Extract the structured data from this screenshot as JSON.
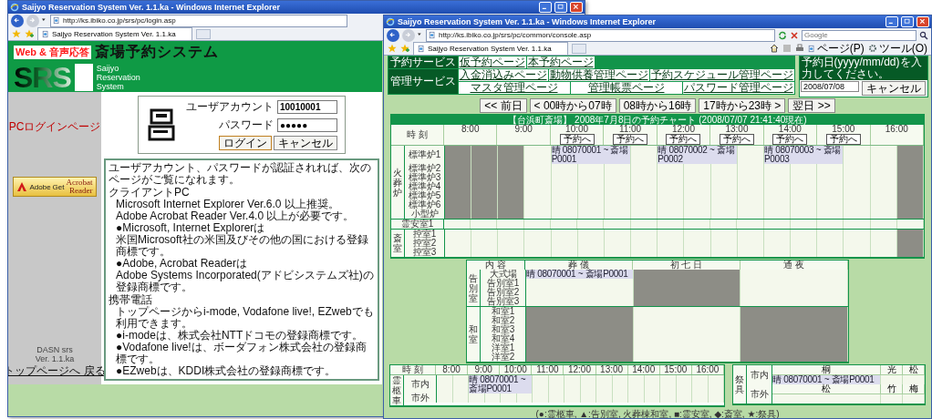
{
  "login_window": {
    "title": "Saijyo Reservation System Ver. 1.1.ka - Windows Internet Explorer",
    "address": "http://ks.ibiko.co.jp/srs/pc/login.asp",
    "tab": "Saijyo Reservation System Ver. 1.1.ka",
    "banner": {
      "tagline": "Web & 音声応答",
      "title": "斎場予約システム",
      "logo": "SRS",
      "subtitle": [
        "Saijyo",
        "Reservation",
        "System"
      ]
    },
    "sidebar": {
      "page_label": "PCログインページ",
      "badge": {
        "get": "Get",
        "name": "Acrobat",
        "reader": "Reader",
        "maker": "Adobe"
      },
      "footer": [
        "DASN srs",
        "Ver. 1.1.ka"
      ],
      "link": "トップページへ 戻る"
    },
    "login": {
      "fields": [
        {
          "label": "ユーザアカウント",
          "value": "10010001"
        },
        {
          "label": "パスワード",
          "value": "●●●●●"
        }
      ],
      "buttons": [
        "ログイン",
        "キャンセル"
      ]
    },
    "notice": {
      "heading": "ユーザアカウント、パスワードが認証されれば、次のページがご覧になれます。",
      "sections": [
        {
          "label": "クライアントPC",
          "lines": [
            "Microsoft Internet Explorer Ver.6.0 以上推奨。",
            "Adobe Acrobat Reader Ver.4.0 以上が必要です。",
            "●Microsoft, Internet Explorerは",
            "米国Microsoft社の米国及びその他の国における登録商標です。",
            "●Adobe, Acrobat Readerは",
            "Adobe Systems Incorporated(アドビシステムズ社)の登録商標です。"
          ]
        },
        {
          "label": "携帯電話",
          "lines": [
            "トップページからi-mode, Vodafone live!, EZwebでも利用できます。",
            "●i-modeは、株式会社NTTドコモの登録商標です。",
            "●Vodafone live!は、ボーダフォン株式会社の登録商標です。",
            "●EZwebは、KDDI株式会社の登録商標です。"
          ]
        }
      ]
    }
  },
  "console_window": {
    "title": "Saijyo Reservation System Ver. 1.1.ka - Windows Internet Explorer",
    "address": "http://ks.ibiko.co.jp/srs/pc/common/console.asp",
    "search": {
      "placeholder": "Google"
    },
    "tab": "Saijyo Reservation System Ver. 1.1.ka",
    "toolbar": [
      "ページ(P)",
      "ツール(O)"
    ],
    "menu": [
      {
        "label": "予約サービス",
        "rows": [
          [
            "仮予約ページ",
            "本予約ページ"
          ]
        ]
      },
      {
        "label": "管理サービス",
        "rows": [
          [
            "入金消込みページ",
            "動物供養管理ページ",
            "予約スケジュール管理ページ"
          ],
          [
            "マスタ管理ページ",
            "管理帳票ページ",
            "パスワード管理ページ"
          ]
        ]
      }
    ],
    "date_box": {
      "prompt": "予約日(yyyy/mm/dd)を入力してください。",
      "value": "2008/07/08",
      "button": "キャンセル"
    },
    "nav": [
      "<< 前日",
      "< 00時から07時",
      "08時から16時",
      "17時から23時 >",
      "翌日 >>"
    ],
    "chart": {
      "title": "【台浜町斎場】 2008年7月8日の予約チャート (2008/07/07 21:41:40現在)",
      "time_label": "時 刻",
      "hours": [
        {
          "time": "8:00"
        },
        {
          "time": "9:00"
        },
        {
          "time": "10:00",
          "button": "予約へ"
        },
        {
          "time": "11:00",
          "button": "予約へ"
        },
        {
          "time": "12:00",
          "button": "予約へ"
        },
        {
          "time": "13:00",
          "button": "予約へ"
        },
        {
          "time": "14:00",
          "button": "予約へ"
        },
        {
          "time": "15:00",
          "button": "予約へ"
        },
        {
          "time": "16:00"
        }
      ],
      "groups": [
        {
          "label": "火葬炉",
          "rows": [
            {
              "label": "標準炉1",
              "cells": [
                {
                  "kind": "blocked"
                },
                {
                  "kind": "blocked"
                },
                {
                  "kind": "blocked"
                },
                {
                  "kind": "free"
                },
                {
                  "kind": "booking",
                  "text": "晴 08070001 ~ 斎場P0001"
                },
                {
                  "kind": "booked"
                },
                {
                  "kind": "booked"
                },
                {
                  "kind": "free"
                },
                {
                  "kind": "booking",
                  "text": "晴 08070002 ~ 斎場P0002"
                },
                {
                  "kind": "booked"
                },
                {
                  "kind": "booked"
                },
                {
                  "kind": "free"
                },
                {
                  "kind": "booking",
                  "text": "晴 08070003 ~ 斎場P0003"
                },
                {
                  "kind": "booked"
                },
                {
                  "kind": "booked"
                },
                {
                  "kind": "free"
                },
                {
                  "kind": "free"
                },
                {
                  "kind": "blocked"
                }
              ]
            },
            {
              "label": "標準炉2",
              "cells": [
                {
                  "kind": "blocked"
                },
                {
                  "kind": "blocked"
                },
                {
                  "kind": "blocked"
                },
                {
                  "kind": "free"
                },
                {
                  "kind": "free"
                },
                {
                  "kind": "free"
                },
                {
                  "kind": "free"
                },
                {
                  "kind": "free"
                },
                {
                  "kind": "free"
                },
                {
                  "kind": "free"
                },
                {
                  "kind": "free"
                },
                {
                  "kind": "free"
                },
                {
                  "kind": "free"
                },
                {
                  "kind": "free"
                },
                {
                  "kind": "free"
                },
                {
                  "kind": "free"
                },
                {
                  "kind": "free"
                },
                {
                  "kind": "blocked"
                }
              ]
            },
            {
              "label": "標準炉3",
              "cells": [
                {
                  "kind": "blocked"
                },
                {
                  "kind": "blocked"
                },
                {
                  "kind": "blocked"
                },
                {
                  "kind": "free"
                },
                {
                  "kind": "free"
                },
                {
                  "kind": "free"
                },
                {
                  "kind": "free"
                },
                {
                  "kind": "free"
                },
                {
                  "kind": "free"
                },
                {
                  "kind": "free"
                },
                {
                  "kind": "free"
                },
                {
                  "kind": "free"
                },
                {
                  "kind": "free"
                },
                {
                  "kind": "free"
                },
                {
                  "kind": "free"
                },
                {
                  "kind": "free"
                },
                {
                  "kind": "free"
                },
                {
                  "kind": "blocked"
                }
              ]
            },
            {
              "label": "標準炉4",
              "cells": [
                {
                  "kind": "blocked"
                },
                {
                  "kind": "blocked"
                },
                {
                  "kind": "blocked"
                },
                {
                  "kind": "free"
                },
                {
                  "kind": "free"
                },
                {
                  "kind": "free"
                },
                {
                  "kind": "free"
                },
                {
                  "kind": "free"
                },
                {
                  "kind": "free"
                },
                {
                  "kind": "free"
                },
                {
                  "kind": "free"
                },
                {
                  "kind": "free"
                },
                {
                  "kind": "free"
                },
                {
                  "kind": "free"
                },
                {
                  "kind": "free"
                },
                {
                  "kind": "free"
                },
                {
                  "kind": "free"
                },
                {
                  "kind": "blocked"
                }
              ]
            },
            {
              "label": "標準炉5",
              "cells": [
                {
                  "kind": "blocked"
                },
                {
                  "kind": "blocked"
                },
                {
                  "kind": "blocked"
                },
                {
                  "kind": "free"
                },
                {
                  "kind": "free"
                },
                {
                  "kind": "free"
                },
                {
                  "kind": "free"
                },
                {
                  "kind": "free"
                },
                {
                  "kind": "free"
                },
                {
                  "kind": "free"
                },
                {
                  "kind": "free"
                },
                {
                  "kind": "free"
                },
                {
                  "kind": "free"
                },
                {
                  "kind": "free"
                },
                {
                  "kind": "free"
                },
                {
                  "kind": "free"
                },
                {
                  "kind": "free"
                },
                {
                  "kind": "blocked"
                }
              ]
            },
            {
              "label": "標準炉6",
              "cells": [
                {
                  "kind": "blocked"
                },
                {
                  "kind": "blocked"
                },
                {
                  "kind": "blocked"
                },
                {
                  "kind": "free"
                },
                {
                  "kind": "free"
                },
                {
                  "kind": "free"
                },
                {
                  "kind": "free"
                },
                {
                  "kind": "free"
                },
                {
                  "kind": "free"
                },
                {
                  "kind": "free"
                },
                {
                  "kind": "free"
                },
                {
                  "kind": "free"
                },
                {
                  "kind": "free"
                },
                {
                  "kind": "free"
                },
                {
                  "kind": "free"
                },
                {
                  "kind": "free"
                },
                {
                  "kind": "free"
                },
                {
                  "kind": "blocked"
                }
              ]
            },
            {
              "label": "小型炉",
              "cells": [
                {
                  "kind": "blocked"
                },
                {
                  "kind": "blocked"
                },
                {
                  "kind": "blocked"
                },
                {
                  "kind": "free"
                },
                {
                  "kind": "free"
                },
                {
                  "kind": "free"
                },
                {
                  "kind": "free"
                },
                {
                  "kind": "free"
                },
                {
                  "kind": "free"
                },
                {
                  "kind": "free"
                },
                {
                  "kind": "free"
                },
                {
                  "kind": "free"
                },
                {
                  "kind": "free"
                },
                {
                  "kind": "free"
                },
                {
                  "kind": "free"
                },
                {
                  "kind": "free"
                },
                {
                  "kind": "free"
                },
                {
                  "kind": "blocked"
                }
              ]
            }
          ]
        },
        {
          "rows": [
            {
              "label": "霊安室1",
              "cells": [
                {
                  "kind": "free"
                },
                {
                  "kind": "free"
                },
                {
                  "kind": "free"
                },
                {
                  "kind": "free"
                },
                {
                  "kind": "free"
                },
                {
                  "kind": "free"
                },
                {
                  "kind": "free"
                },
                {
                  "kind": "free"
                },
                {
                  "kind": "free"
                },
                {
                  "kind": "free"
                },
                {
                  "kind": "free"
                },
                {
                  "kind": "free"
                },
                {
                  "kind": "free"
                },
                {
                  "kind": "free"
                },
                {
                  "kind": "free"
                },
                {
                  "kind": "free"
                },
                {
                  "kind": "free"
                },
                {
                  "kind": "free"
                }
              ]
            }
          ]
        },
        {
          "label": "斎室",
          "rows": [
            {
              "label": "控室1",
              "cells": [
                {
                  "kind": "free"
                },
                {
                  "kind": "free"
                },
                {
                  "kind": "free"
                },
                {
                  "kind": "free"
                },
                {
                  "kind": "free"
                },
                {
                  "kind": "free"
                },
                {
                  "kind": "free"
                },
                {
                  "kind": "free"
                },
                {
                  "kind": "free"
                },
                {
                  "kind": "free"
                },
                {
                  "kind": "free"
                },
                {
                  "kind": "free"
                },
                {
                  "kind": "free"
                },
                {
                  "kind": "free"
                },
                {
                  "kind": "free"
                },
                {
                  "kind": "free"
                },
                {
                  "kind": "free"
                },
                {
                  "kind": "blocked"
                }
              ]
            },
            {
              "label": "控室2",
              "cells": [
                {
                  "kind": "free"
                },
                {
                  "kind": "free"
                },
                {
                  "kind": "free"
                },
                {
                  "kind": "free"
                },
                {
                  "kind": "free"
                },
                {
                  "kind": "free"
                },
                {
                  "kind": "free"
                },
                {
                  "kind": "free"
                },
                {
                  "kind": "free"
                },
                {
                  "kind": "free"
                },
                {
                  "kind": "free"
                },
                {
                  "kind": "free"
                },
                {
                  "kind": "free"
                },
                {
                  "kind": "free"
                },
                {
                  "kind": "free"
                },
                {
                  "kind": "free"
                },
                {
                  "kind": "free"
                },
                {
                  "kind": "blocked"
                }
              ]
            },
            {
              "label": "控室3",
              "cells": [
                {
                  "kind": "free"
                },
                {
                  "kind": "free"
                },
                {
                  "kind": "free"
                },
                {
                  "kind": "free"
                },
                {
                  "kind": "free"
                },
                {
                  "kind": "free"
                },
                {
                  "kind": "free"
                },
                {
                  "kind": "free"
                },
                {
                  "kind": "free"
                },
                {
                  "kind": "free"
                },
                {
                  "kind": "free"
                },
                {
                  "kind": "free"
                },
                {
                  "kind": "free"
                },
                {
                  "kind": "free"
                },
                {
                  "kind": "free"
                },
                {
                  "kind": "free"
                },
                {
                  "kind": "free"
                },
                {
                  "kind": "blocked"
                }
              ]
            }
          ]
        }
      ]
    },
    "rooms": {
      "head": "内 容",
      "columns": [
        "葬 儀",
        "初 七 日",
        "通 夜"
      ],
      "groups": [
        {
          "label": "告別室",
          "rows": [
            {
              "label": "大式場",
              "cells": [
                {
                  "kind": "booking",
                  "text": "晴 08070001 ~ 斎場P0001"
                },
                {
                  "kind": "blocked"
                },
                {
                  "kind": "free"
                }
              ]
            },
            {
              "label": "告別室1",
              "cells": [
                {
                  "kind": "free"
                },
                {
                  "kind": "blocked"
                },
                {
                  "kind": "free"
                }
              ]
            },
            {
              "label": "告別室2",
              "cells": [
                {
                  "kind": "free"
                },
                {
                  "kind": "blocked"
                },
                {
                  "kind": "free"
                }
              ]
            },
            {
              "label": "告別室3",
              "cells": [
                {
                  "kind": "free"
                },
                {
                  "kind": "blocked"
                },
                {
                  "kind": "free"
                }
              ]
            }
          ]
        },
        {
          "label": "和室",
          "rows": [
            {
              "label": "和室1",
              "cells": [
                {
                  "kind": "blocked"
                },
                {
                  "kind": "free"
                },
                {
                  "kind": "blocked"
                }
              ]
            },
            {
              "label": "和室2",
              "cells": [
                {
                  "kind": "blocked"
                },
                {
                  "kind": "free"
                },
                {
                  "kind": "blocked"
                }
              ]
            },
            {
              "label": "和室3",
              "cells": [
                {
                  "kind": "blocked"
                },
                {
                  "kind": "free"
                },
                {
                  "kind": "blocked"
                }
              ]
            },
            {
              "label": "和室4",
              "cells": [
                {
                  "kind": "blocked"
                },
                {
                  "kind": "free"
                },
                {
                  "kind": "blocked"
                }
              ]
            },
            {
              "label": "洋室1",
              "cells": [
                {
                  "kind": "blocked"
                },
                {
                  "kind": "free"
                },
                {
                  "kind": "blocked"
                }
              ]
            },
            {
              "label": "洋室2",
              "cells": [
                {
                  "kind": "blocked"
                },
                {
                  "kind": "free"
                },
                {
                  "kind": "blocked"
                }
              ]
            }
          ]
        }
      ]
    },
    "hearse": {
      "time_label": "時 刻",
      "hours": [
        "8:00",
        "9:00",
        "10:00",
        "11:00",
        "12:00",
        "13:00",
        "14:00",
        "15:00",
        "16:00"
      ],
      "label": "霊柩車",
      "rows": [
        {
          "label": "市内",
          "cells": [
            {
              "kind": "free"
            },
            {
              "kind": "free"
            },
            {
              "kind": "booking",
              "text": "晴 08070001 ~ 斎場P0001"
            },
            {
              "kind": "booked"
            },
            {
              "kind": "booked"
            },
            {
              "kind": "booked"
            },
            {
              "kind": "free"
            },
            {
              "kind": "free"
            },
            {
              "kind": "free"
            },
            {
              "kind": "free"
            },
            {
              "kind": "free"
            },
            {
              "kind": "free"
            },
            {
              "kind": "free"
            },
            {
              "kind": "free"
            },
            {
              "kind": "free"
            },
            {
              "kind": "free"
            },
            {
              "kind": "free"
            },
            {
              "kind": "free"
            }
          ]
        },
        {
          "label": "市外",
          "cells": [
            {
              "kind": "free"
            },
            {
              "kind": "free"
            },
            {
              "kind": "free"
            },
            {
              "kind": "free"
            },
            {
              "kind": "free"
            },
            {
              "kind": "free"
            },
            {
              "kind": "free"
            },
            {
              "kind": "free"
            },
            {
              "kind": "free"
            },
            {
              "kind": "free"
            },
            {
              "kind": "free"
            },
            {
              "kind": "free"
            },
            {
              "kind": "free"
            },
            {
              "kind": "free"
            },
            {
              "kind": "free"
            },
            {
              "kind": "free"
            },
            {
              "kind": "free"
            },
            {
              "kind": "free"
            }
          ]
        }
      ]
    },
    "altar": {
      "label": "祭具",
      "rows": [
        {
          "label": "市内",
          "items": [
            {
              "name": "桐",
              "booking": "晴 08070001 ~ 斎場P0001"
            },
            {
              "name": "光"
            },
            {
              "name": "松"
            }
          ]
        },
        {
          "label": "市外",
          "items": [
            {
              "name": "松"
            },
            {
              "name": "竹"
            },
            {
              "name": "梅"
            }
          ]
        }
      ]
    },
    "legend": "(●:霊柩車, ▲:告別室, 火葬棟和室, ■:霊安室, ◆:斎室, ★:祭具)"
  }
}
